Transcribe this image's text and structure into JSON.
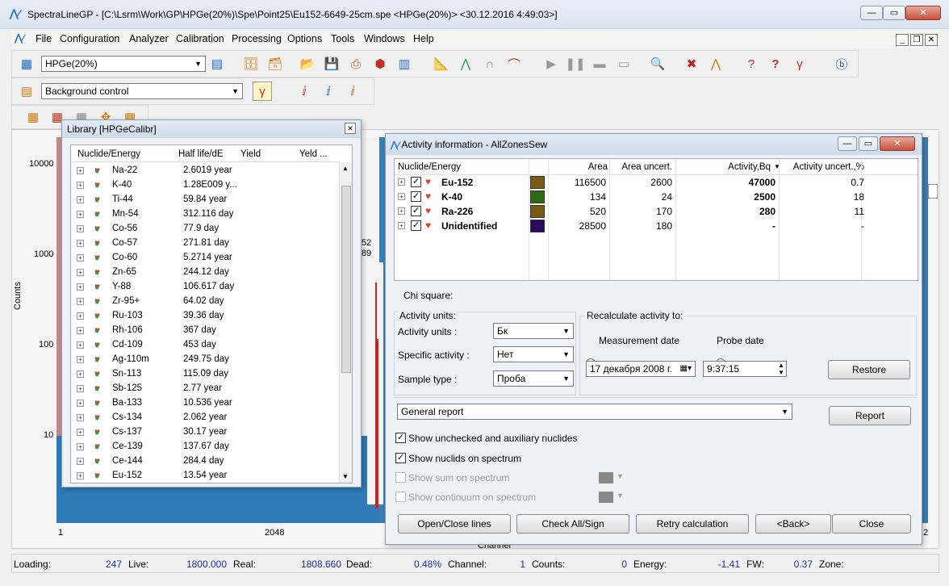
{
  "app": {
    "title": "SpectraLineGP - [C:\\Lsrm\\Work\\GP\\HPGe(20%)\\Spe\\Point25\\Eu152-6649-25cm.spe <HPGe(20%)> <30.12.2016 4:49:03>]",
    "menu": [
      "File",
      "Configuration",
      "Analyzer",
      "Calibration",
      "Processing",
      "Options",
      "Tools",
      "Windows",
      "Help"
    ],
    "detector_combo": "HPGe(20%)",
    "background_combo": "Background control"
  },
  "spectrum": {
    "y_axis_title": "Counts",
    "y_ticks": [
      "10000",
      "1000",
      "100",
      "10"
    ],
    "x_ticks": [
      "1",
      "2048"
    ],
    "x_tick_right": "2",
    "x_axis_title": "Channel",
    "peak_labels": [
      "52",
      "89"
    ]
  },
  "library": {
    "title": "Library [HPGeCalibr]",
    "columns": [
      "Nuclide/Energy",
      "Half life/dE",
      "Yield",
      "Yeld ..."
    ],
    "rows": [
      {
        "nuclide": "Na-22",
        "half_life": "2.6019 year"
      },
      {
        "nuclide": "K-40",
        "half_life": "1.28E009 y..."
      },
      {
        "nuclide": "Ti-44",
        "half_life": "59.84 year"
      },
      {
        "nuclide": "Mn-54",
        "half_life": "312.116 day"
      },
      {
        "nuclide": "Co-56",
        "half_life": "77.9 day"
      },
      {
        "nuclide": "Co-57",
        "half_life": "271.81 day"
      },
      {
        "nuclide": "Co-60",
        "half_life": "5.2714 year"
      },
      {
        "nuclide": "Zn-65",
        "half_life": "244.12 day"
      },
      {
        "nuclide": "Y-88",
        "half_life": "106.617 day"
      },
      {
        "nuclide": "Zr-95+",
        "half_life": "64.02 day"
      },
      {
        "nuclide": "Ru-103",
        "half_life": "39.36 day"
      },
      {
        "nuclide": "Rh-106",
        "half_life": "367 day"
      },
      {
        "nuclide": "Cd-109",
        "half_life": "453 day"
      },
      {
        "nuclide": "Ag-110m",
        "half_life": "249.75 day"
      },
      {
        "nuclide": "Sn-113",
        "half_life": "115.09 day"
      },
      {
        "nuclide": "Sb-125",
        "half_life": "2.77 year"
      },
      {
        "nuclide": "Ba-133",
        "half_life": "10.536 year"
      },
      {
        "nuclide": "Cs-134",
        "half_life": "2.062 year"
      },
      {
        "nuclide": "Cs-137",
        "half_life": "30.17 year"
      },
      {
        "nuclide": "Ce-139",
        "half_life": "137.67 day"
      },
      {
        "nuclide": "Ce-144",
        "half_life": "284.4 day"
      },
      {
        "nuclide": "Eu-152",
        "half_life": "13.54 year"
      }
    ]
  },
  "activity": {
    "title": "Activity information - AllZonesSew",
    "columns": [
      "Nuclide/Energy",
      "Area",
      "Area uncert.",
      "Activity,Bq",
      "Activity uncert.,%"
    ],
    "rows": [
      {
        "nuclide": "Eu-152",
        "color": "#7a5a10",
        "area": "116500",
        "area_unc": "2600",
        "activity": "47000",
        "act_unc": "0.7"
      },
      {
        "nuclide": "K-40",
        "color": "#2f6a10",
        "area": "134",
        "area_unc": "24",
        "activity": "2500",
        "act_unc": "18"
      },
      {
        "nuclide": "Ra-226",
        "color": "#7a5a10",
        "area": "520",
        "area_unc": "170",
        "activity": "280",
        "act_unc": "11"
      },
      {
        "nuclide": "Unidentified",
        "color": "#2a0a60",
        "area": "28500",
        "area_unc": "180",
        "activity": "-",
        "act_unc": "-"
      }
    ],
    "chi_square_label": "Chi square:",
    "units_group": "Activity units:",
    "activity_units_label": "Activity units :",
    "activity_units_value": "Бк",
    "specific_activity_label": "Specific activity :",
    "specific_activity_value": "Нет",
    "sample_type_label": "Sample type :",
    "sample_type_value": "Проба",
    "recalc_group": "Recalculate activity to:",
    "measurement_date_label": "Measurement date",
    "probe_date_label": "Probe date",
    "date_value": "17 декабря  2008 г.",
    "time_value": "9:37:15",
    "restore_label": "Restore",
    "report_combo": "General report",
    "report_label": "Report",
    "opt_unchecked": "Show unchecked and auxiliary nuclides",
    "opt_nuclids": "Show nuclids on spectrum",
    "opt_sum": "Show sum on spectrum",
    "opt_continuum": "Show continuum on spectrum",
    "btn_open_close": "Open/Close lines",
    "btn_check_all": "Check All/Sign",
    "btn_retry": "Retry calculation",
    "btn_back": "<Back>",
    "btn_close": "Close"
  },
  "status": {
    "loading_label": "Loading:",
    "loading": "247",
    "live_label": "Live:",
    "live": "1800.000",
    "real_label": "Real:",
    "real": "1808.660",
    "dead_label": "Dead:",
    "dead": "0.48%",
    "channel_label": "Channel:",
    "channel": "1",
    "counts_label": "Counts:",
    "counts": "0",
    "energy_label": "Energy:",
    "energy": "-1.41",
    "fw_label": "FW:",
    "fw": "0.37",
    "zone_label": "Zone:"
  }
}
